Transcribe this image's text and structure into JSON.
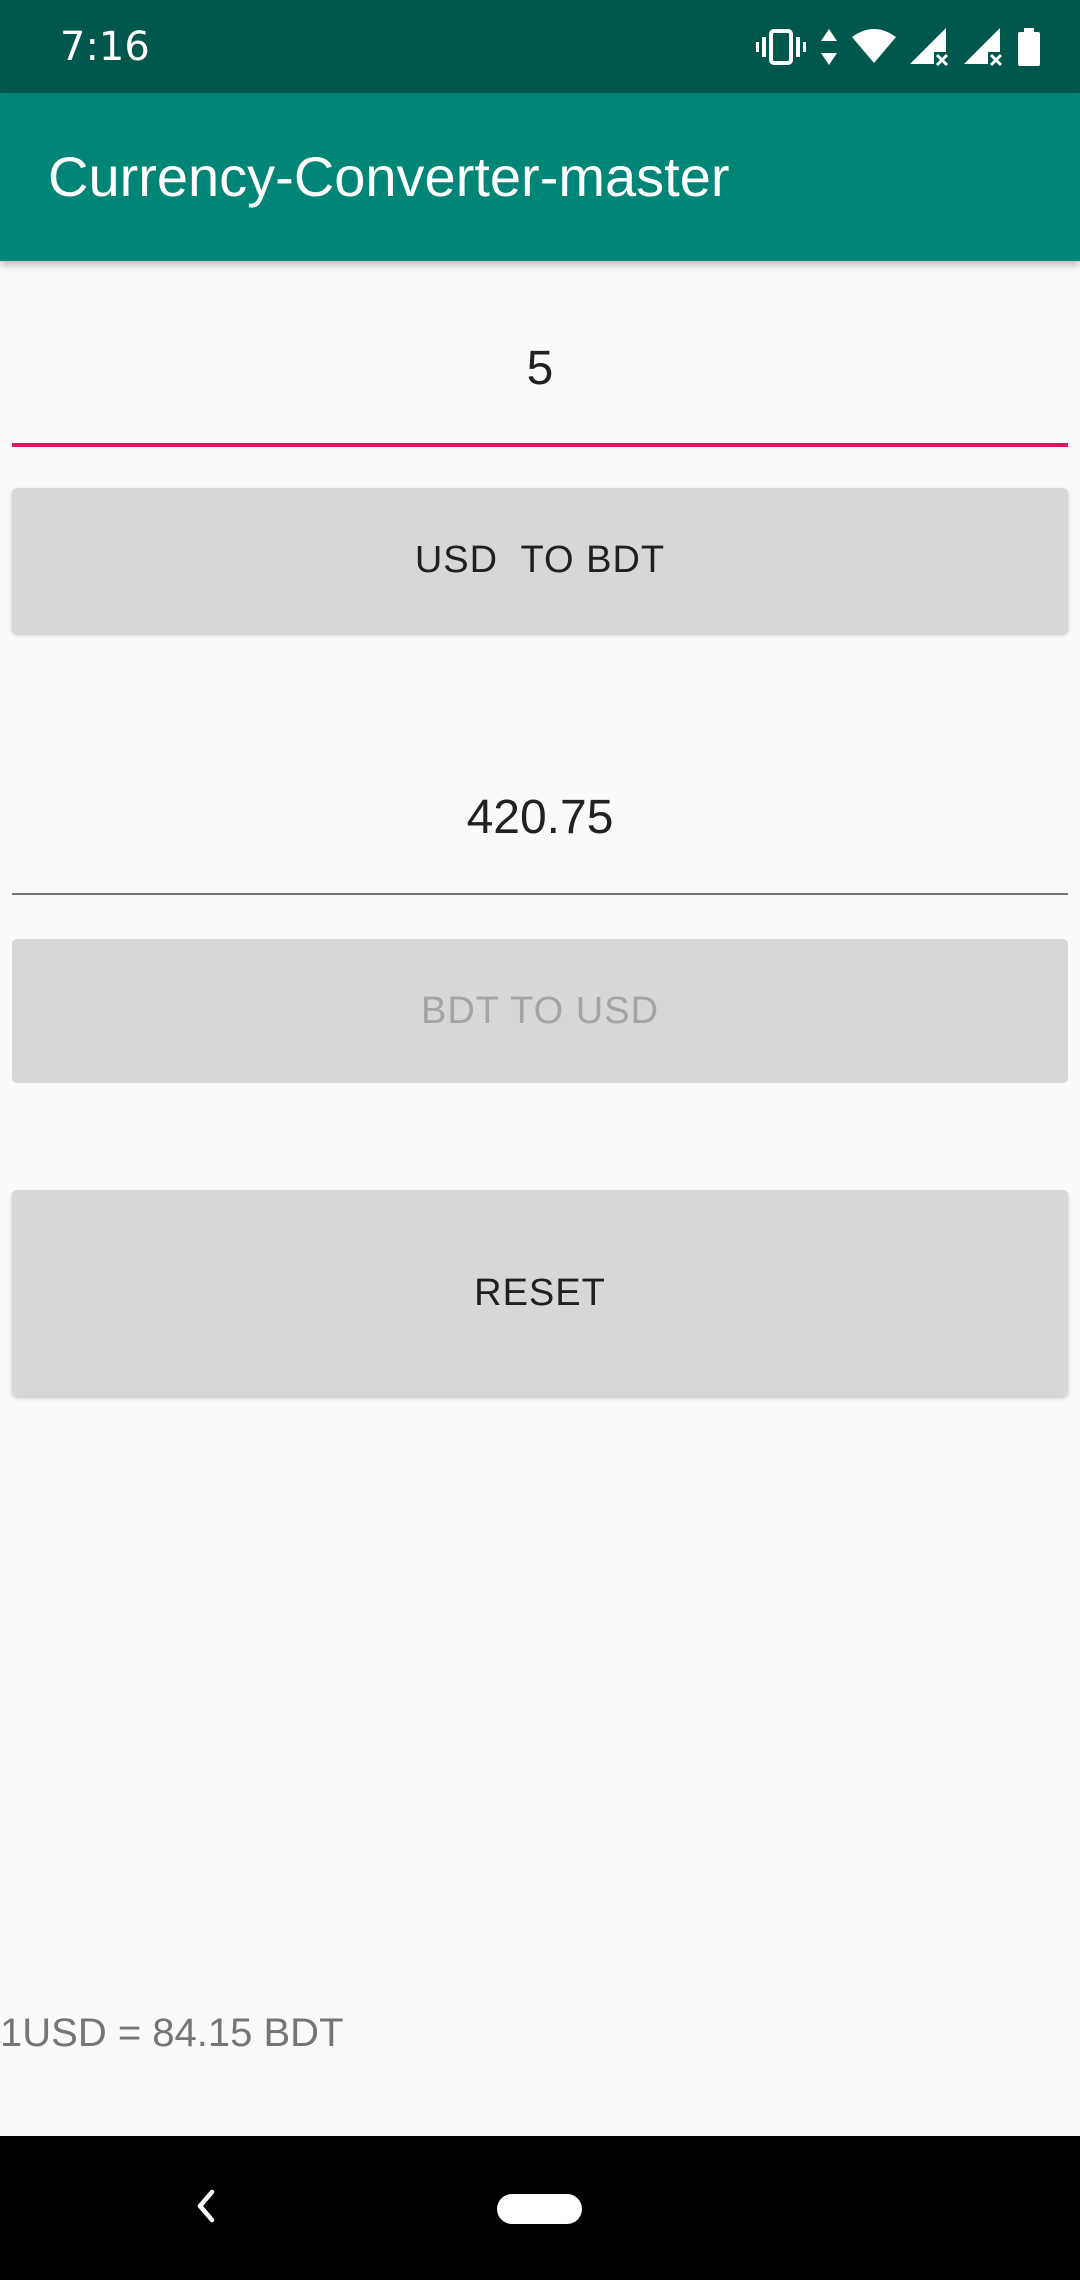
{
  "status_bar": {
    "time": "7:16",
    "icons": [
      "vibrate-icon",
      "data-arrows-icon",
      "wifi-icon",
      "signal-no-service-icon",
      "signal-no-service-icon",
      "battery-icon"
    ]
  },
  "app_bar": {
    "title": "Currency-Converter-master"
  },
  "usd_input": {
    "value": "5"
  },
  "usd_to_bdt_button": {
    "label": "USD  TO BDT"
  },
  "bdt_input": {
    "value": "420.75"
  },
  "bdt_to_usd_button": {
    "label": "BDT TO USD",
    "enabled": false
  },
  "reset_button": {
    "label": "RESET"
  },
  "rate_text": "1USD = 84.15 BDT",
  "nav_bar": {
    "icons": [
      "back-icon",
      "home-pill-icon"
    ]
  },
  "colors": {
    "status_bar": "#00574b",
    "app_bar": "#008577",
    "accent": "#d81b60",
    "button": "#d6d7d7",
    "background": "#fafafa"
  }
}
